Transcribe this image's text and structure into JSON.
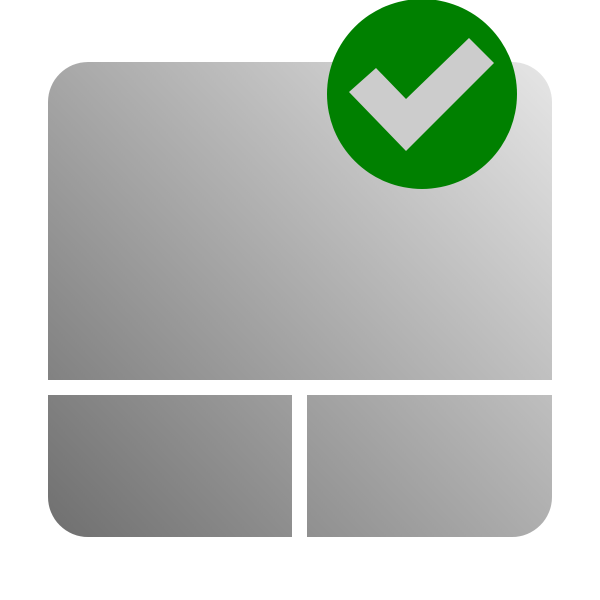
{
  "icon": {
    "name": "touchpad-enabled",
    "depicts": [
      "touchpad-icon",
      "checkmark-badge-icon"
    ]
  },
  "colors": {
    "background": "#ffffff",
    "pad_gradient_light": "#e6e6e6",
    "pad_gradient_dark": "#6f6f6f",
    "separator": "#ffffff",
    "badge_fill": "#008000",
    "checkmark_fill": "#cccccc"
  }
}
